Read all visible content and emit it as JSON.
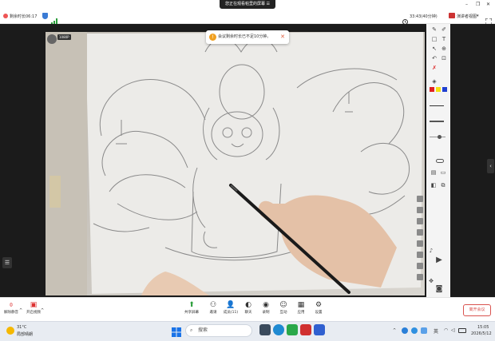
{
  "topbar": {
    "sharing_banner": "您正在观看帕里的屏幕",
    "remaining_time": "剩余时长06:17",
    "time_duration": "33:43(40分钟)",
    "view_label": "演讲者视图"
  },
  "toast": {
    "message": "会议剩余时长已不足10分钟。"
  },
  "video_tag": "1080P",
  "controls": {
    "mute": "解除静音",
    "video": "开启视频",
    "share": "共享屏幕",
    "invite": "邀请",
    "members": "成员(11)",
    "chat": "聊天",
    "record": "录制",
    "interact": "互动",
    "apps": "应用",
    "settings": "设置",
    "leave": "离开会议"
  },
  "taskbar": {
    "weather_temp": "31°C",
    "weather_desc": "局部晴朗",
    "search_placeholder": "搜索",
    "ime": "英",
    "time": "15:05",
    "date": "2026/5/12"
  },
  "colors": {
    "red": "#e02020",
    "yellow": "#f4e010",
    "blue": "#2040d0",
    "leave_red": "#d9534f",
    "toast_warn": "#f0a020"
  }
}
